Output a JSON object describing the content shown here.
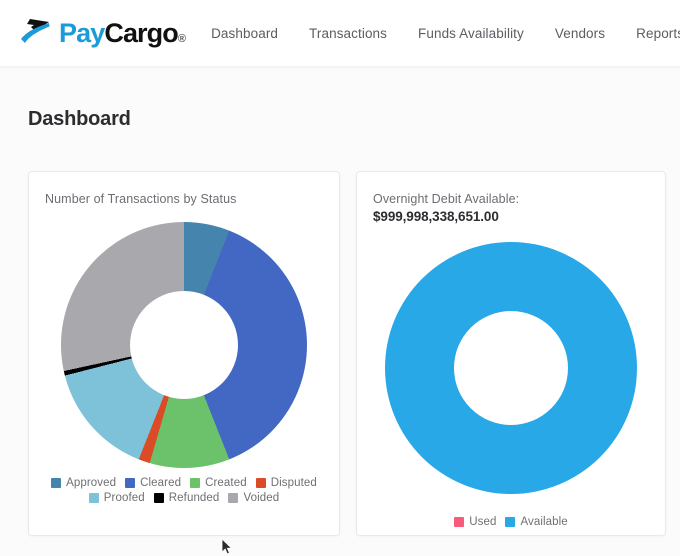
{
  "brand": {
    "logo_pay": "Pay",
    "logo_cargo": "Cargo",
    "logo_registered": "®",
    "logo_mark_icon": "paycargo-arrow-icon",
    "blue": "#1b9bd8",
    "black": "#111111"
  },
  "nav": {
    "items": [
      {
        "label": "Dashboard"
      },
      {
        "label": "Transactions"
      },
      {
        "label": "Funds Availability"
      },
      {
        "label": "Vendors"
      },
      {
        "label": "Reports"
      }
    ]
  },
  "page": {
    "title": "Dashboard",
    "background": "#fbfbfc"
  },
  "cards": {
    "transactions": {
      "title": "Number of Transactions by Status"
    },
    "overnight": {
      "title": "Overnight Debit Available:",
      "amount": "$999,998,338,651.00"
    }
  },
  "chart_data": [
    {
      "type": "pie",
      "variant": "donut",
      "title": "Number of Transactions by Status",
      "legend_position": "bottom",
      "start_angle_deg": 0,
      "direction": "clockwise",
      "categories": [
        "Approved",
        "Cleared",
        "Created",
        "Disputed",
        "Proofed",
        "Refunded",
        "Voided"
      ],
      "values": [
        6,
        38,
        10.5,
        1.5,
        15,
        0.6,
        28.4
      ],
      "unit": "percent",
      "colors": [
        "#4585ad",
        "#4268c4",
        "#6cc16b",
        "#db4b25",
        "#7dc2d8",
        "#000000",
        "#a8a8ad"
      ]
    },
    {
      "type": "pie",
      "variant": "donut",
      "title": "Overnight Debit Available: $999,998,338,651.00",
      "legend_position": "bottom",
      "categories": [
        "Used",
        "Available"
      ],
      "values": [
        0,
        100
      ],
      "unit": "percent",
      "colors": [
        "#f75a7a",
        "#29a8e8"
      ]
    }
  ],
  "legends": {
    "transactions": [
      {
        "label": "Approved",
        "color": "#4585ad"
      },
      {
        "label": "Cleared",
        "color": "#4268c4"
      },
      {
        "label": "Created",
        "color": "#6cc16b"
      },
      {
        "label": "Disputed",
        "color": "#db4b25"
      },
      {
        "label": "Proofed",
        "color": "#7dc2d8"
      },
      {
        "label": "Refunded",
        "color": "#000000"
      },
      {
        "label": "Voided",
        "color": "#a8a8ad"
      }
    ],
    "overnight": [
      {
        "label": "Used",
        "color": "#f75a7a"
      },
      {
        "label": "Available",
        "color": "#29a8e8"
      }
    ]
  },
  "cursor": {
    "icon": "mouse-pointer-icon"
  }
}
